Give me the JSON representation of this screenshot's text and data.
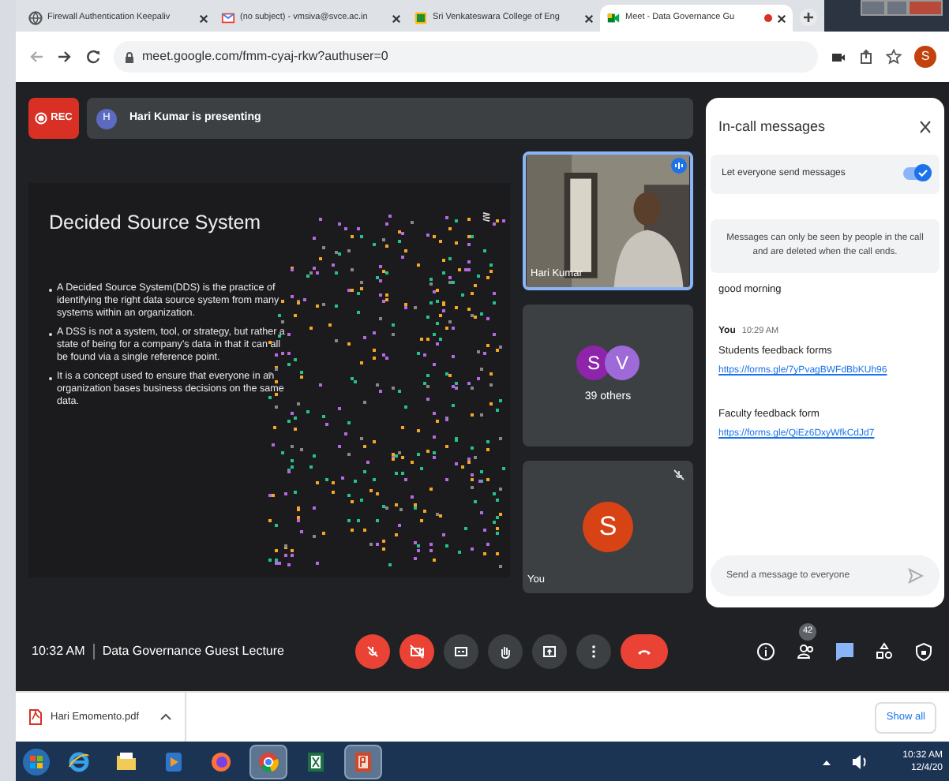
{
  "browser": {
    "tabs": [
      {
        "title": "Firewall Authentication Keepaliv",
        "selected": false,
        "recording": false
      },
      {
        "title": "(no subject) - vmsiva@svce.ac.in",
        "selected": false,
        "recording": false
      },
      {
        "title": "Sri Venkateswara College of Eng",
        "selected": false,
        "recording": false
      },
      {
        "title": "Meet - Data Governance Gu",
        "selected": true,
        "recording": true
      }
    ],
    "url": "meet.google.com/fmm-cyaj-rkw?authuser=0",
    "profile": "S"
  },
  "meet": {
    "rec": "REC",
    "presenter": {
      "initial": "H",
      "text": "Hari Kumar is presenting"
    },
    "slide": {
      "title": "Decided Source System",
      "bullets": [
        "A Decided Source System(DDS) is the practice of identifying the right data source system from many systems within an organization.",
        "A DSS is not a system, tool, or strategy, but rather a state of being for a company's data in that it can all be found via a single reference point.",
        "It is a concept used to ensure that everyone in an organization bases business decisions on the same data."
      ]
    },
    "tiles": [
      {
        "kind": "video",
        "name": "Hari Kumar",
        "speaking": true
      },
      {
        "kind": "group",
        "avatars": [
          {
            "letter": "S",
            "color": "#8e24aa"
          },
          {
            "letter": "V",
            "color": "#9e6ad8"
          }
        ],
        "label": "39 others"
      },
      {
        "kind": "self",
        "letter": "S",
        "color": "#d84315",
        "name": "You",
        "muted": true
      }
    ],
    "chat": {
      "title": "In-call messages",
      "toggle": {
        "label": "Let everyone send messages",
        "checked": true
      },
      "notice": "Messages can only be seen by people in the call and are deleted when the call ends.",
      "messages": [
        {
          "lines": [
            {
              "kind": "text",
              "text": "good morning"
            }
          ]
        },
        {
          "sender": "You",
          "time": "10:29 AM",
          "lines": [
            {
              "kind": "text",
              "text": "Students feedback forms"
            },
            {
              "kind": "link",
              "text": "https://forms.gle/7yPvagBWFdBbKUh96"
            }
          ]
        },
        {
          "lines": [
            {
              "kind": "text",
              "text": "Faculty feedback form"
            },
            {
              "kind": "link",
              "text": "https://forms.gle/QiEz6DxyWfkCdJd7"
            }
          ]
        }
      ],
      "input": {
        "placeholder": "Send a message to everyone"
      }
    },
    "bottom": {
      "time": "10:32 AM",
      "title": "Data Governance Guest Lecture",
      "controls": [
        {
          "kind": "mic",
          "off": true
        },
        {
          "kind": "camera",
          "off": true
        },
        {
          "kind": "captions",
          "off": false
        },
        {
          "kind": "hand",
          "off": false
        },
        {
          "kind": "present",
          "off": false
        },
        {
          "kind": "more",
          "off": false
        },
        {
          "kind": "end"
        }
      ],
      "side": [
        {
          "kind": "info",
          "selected": false
        },
        {
          "kind": "people",
          "badge": "42",
          "selected": false
        },
        {
          "kind": "chat",
          "selected": true
        },
        {
          "kind": "activities",
          "selected": false
        },
        {
          "kind": "lock",
          "selected": false
        }
      ]
    }
  },
  "download": {
    "file": "Hari Emomento.pdf",
    "show_all": "Show all"
  },
  "taskbar": {
    "apps": [
      {
        "kind": "ie",
        "active": false
      },
      {
        "kind": "folder",
        "active": false
      },
      {
        "kind": "media",
        "active": false
      },
      {
        "kind": "firefox",
        "active": false
      },
      {
        "kind": "chrome",
        "active": true
      },
      {
        "kind": "excel",
        "active": false
      },
      {
        "kind": "powerpoint",
        "active": true
      }
    ],
    "time": "10:32 AM",
    "date": "12/4/20"
  }
}
